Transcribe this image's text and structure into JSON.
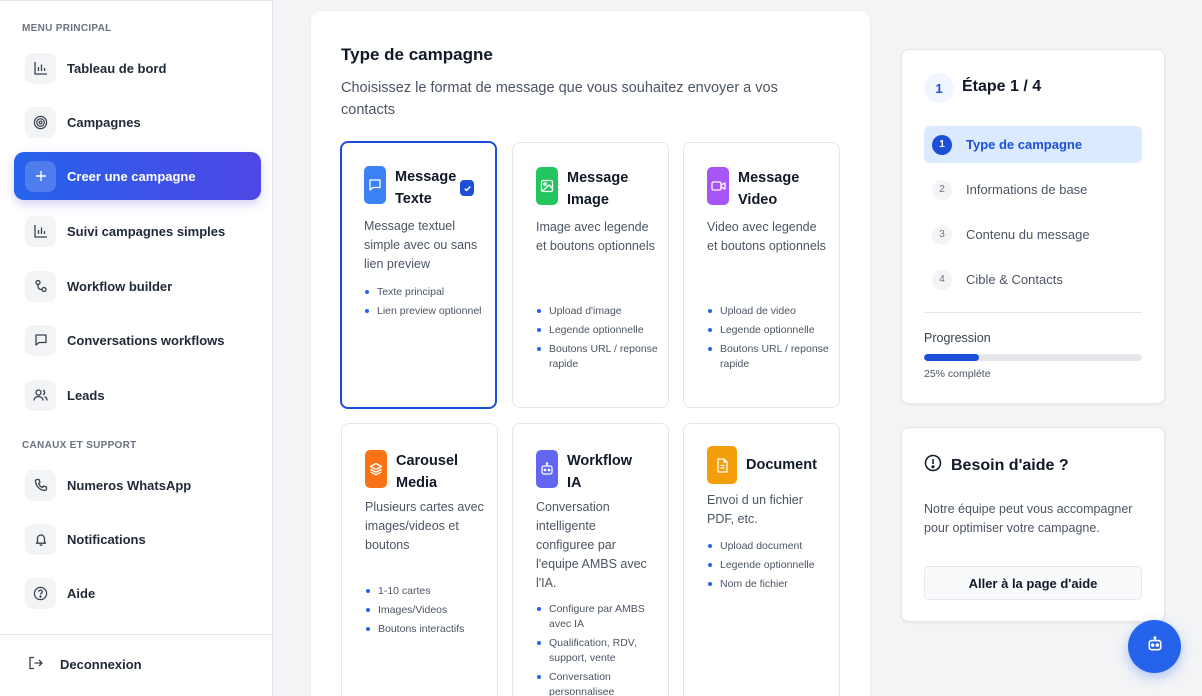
{
  "sidebar": {
    "section_main": "MENU PRINCIPAL",
    "section_channels": "CANAUX ET SUPPORT",
    "items": [
      {
        "label": "Tableau de bord",
        "icon": "bar-chart-icon"
      },
      {
        "label": "Campagnes",
        "icon": "target-icon"
      },
      {
        "label": "Creer une campagne",
        "icon": "plus-icon",
        "active": true
      },
      {
        "label": "Suivi campagnes simples",
        "icon": "bar-chart-icon"
      },
      {
        "label": "Workflow builder",
        "icon": "workflow-icon"
      },
      {
        "label": "Conversations workflows",
        "icon": "chat-icon"
      },
      {
        "label": "Leads",
        "icon": "users-icon"
      }
    ],
    "support_items": [
      {
        "label": "Numeros WhatsApp",
        "icon": "phone-icon"
      },
      {
        "label": "Notifications",
        "icon": "bell-icon"
      },
      {
        "label": "Aide",
        "icon": "help-circle-icon"
      }
    ],
    "logout": "Deconnexion"
  },
  "main": {
    "title": "Type de campagne",
    "subtitle": "Choisissez le format de message que vous souhaitez envoyer a vos contacts",
    "options": [
      {
        "title": "Message Texte",
        "desc": "Message textuel simple avec ou sans lien preview",
        "features": [
          "Texte principal",
          "Lien preview optionnel"
        ],
        "color": "#3b82f6",
        "selected": true
      },
      {
        "title": "Message Image",
        "desc": "Image avec legende et boutons optionnels",
        "features": [
          "Upload d'image",
          "Legende optionnelle",
          "Boutons URL / reponse rapide"
        ],
        "color": "#22c55e"
      },
      {
        "title": "Message Video",
        "desc": "Video avec legende et boutons optionnels",
        "features": [
          "Upload de video",
          "Legende optionnelle",
          "Boutons URL / reponse rapide"
        ],
        "color": "#a855f7"
      },
      {
        "title": "Carousel Media",
        "desc": "Plusieurs cartes avec images/videos et boutons",
        "features": [
          "1-10 cartes",
          "Images/Videos",
          "Boutons interactifs"
        ],
        "color": "#f97316"
      },
      {
        "title": "Workflow IA",
        "desc": "Conversation intelligente configuree par l'equipe AMBS avec l'IA.",
        "features": [
          "Configure par AMBS avec IA",
          "Qualification, RDV, support, vente",
          "Conversation personnalisee"
        ],
        "color": "#6366f1"
      },
      {
        "title": "Document",
        "desc": "Envoi d un fichier PDF, etc.",
        "features": [
          "Upload document",
          "Legende optionnelle",
          "Nom de fichier"
        ],
        "color": "#f59e0b"
      }
    ]
  },
  "steps": {
    "current": "1",
    "title": "Étape 1 / 4",
    "items": [
      {
        "num": "1",
        "label": "Type de campagne",
        "active": true
      },
      {
        "num": "2",
        "label": "Informations de base"
      },
      {
        "num": "3",
        "label": "Contenu du message"
      },
      {
        "num": "4",
        "label": "Cible & Contacts"
      }
    ],
    "progress_label": "Progression",
    "progress_value": 0.25,
    "progress_text": "25% compléte"
  },
  "help": {
    "title": "Besoin d'aide ?",
    "text": "Notre équipe peut vous accompagner pour optimiser votre campagne.",
    "button": "Aller à la page d'aide"
  },
  "colors": {
    "accent": "#1d4ed8",
    "fab": "#2563eb"
  }
}
